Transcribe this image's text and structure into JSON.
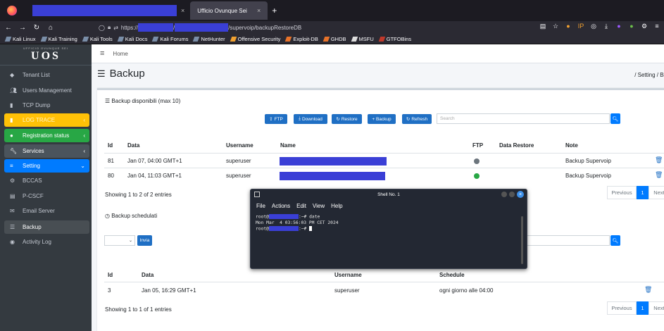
{
  "browser": {
    "active_tab_title": "Ufficio Ovunque Sei",
    "tab_close": "×",
    "new_tab": "+",
    "url_prefix": "https://",
    "url_sep": "/",
    "url_suffix": "/supervoip/backupRestoreDB",
    "bookmarks": [
      "Kali Linux",
      "Kali Training",
      "Kali Tools",
      "Kali Docs",
      "Kali Forums",
      "NetHunter",
      "Offensive Security",
      "Exploit-DB",
      "GHDB",
      "MSFU",
      "GTFOBins"
    ]
  },
  "sidebar": {
    "logo_small": "UFFICIO OVUNQUE SEI",
    "logo": "UOS",
    "items": [
      {
        "label": "Tenant List"
      },
      {
        "label": "Users Management"
      },
      {
        "label": "TCP Dump"
      },
      {
        "label": "LOG TRACE"
      },
      {
        "label": "Registration status"
      },
      {
        "label": "Services"
      },
      {
        "label": "Setting"
      },
      {
        "label": "BCCAS"
      },
      {
        "label": "P-CSCF"
      },
      {
        "label": "Email Server"
      },
      {
        "label": "Backup"
      },
      {
        "label": "Activity Log"
      }
    ]
  },
  "topnav": {
    "home": "Home"
  },
  "page": {
    "title": "Backup",
    "breadcrumb": "/ Setting / Ba"
  },
  "backups": {
    "title": "Backup disponibili (max 10)",
    "buttons": {
      "ftp": "FTP",
      "download": "Download",
      "restore": "Restore",
      "backup": "+ Backup",
      "refresh": "Refresh"
    },
    "search_placeholder": "Search",
    "columns": [
      "Id",
      "Data",
      "Username",
      "Name",
      "FTP",
      "Data Restore",
      "Note"
    ],
    "rows": [
      {
        "id": "81",
        "data": "Jan 07, 04:00 GMT+1",
        "username": "superuser",
        "ftp_status": "grey",
        "note": "Backup Supervoip"
      },
      {
        "id": "80",
        "data": "Jan 04, 11:03 GMT+1",
        "username": "superuser",
        "ftp_status": "green",
        "note": "Backup Supervoip"
      }
    ],
    "showing": "Showing 1 to 2 of 2 entries",
    "pager": {
      "previous": "Previous",
      "page": "1",
      "next": "Next"
    }
  },
  "scheduled": {
    "title": "Backup schedulati",
    "invia": "Invia",
    "columns": [
      "Id",
      "Data",
      "Username",
      "Schedule"
    ],
    "rows": [
      {
        "id": "3",
        "data": "Jan 05, 16:29 GMT+1",
        "username": "superuser",
        "schedule": "ogni giorno alle 04:00"
      }
    ],
    "showing": "Showing 1 to 1 of 1 entries",
    "pager": {
      "previous": "Previous",
      "page": "1",
      "next": "Next"
    }
  },
  "terminal": {
    "title": "Shell No. 1",
    "menu": [
      "File",
      "Actions",
      "Edit",
      "View",
      "Help"
    ],
    "line1_prefix": "root@",
    "line1_suffix": ":~# date",
    "line2": "Mon Mar  4 03:56:03 PM CET 2024",
    "line3_prefix": "root@",
    "line3_suffix": ":~# "
  },
  "colors": {
    "redaction": "#3a3fd6",
    "primary": "#007bff",
    "sidebar": "#343a40"
  }
}
